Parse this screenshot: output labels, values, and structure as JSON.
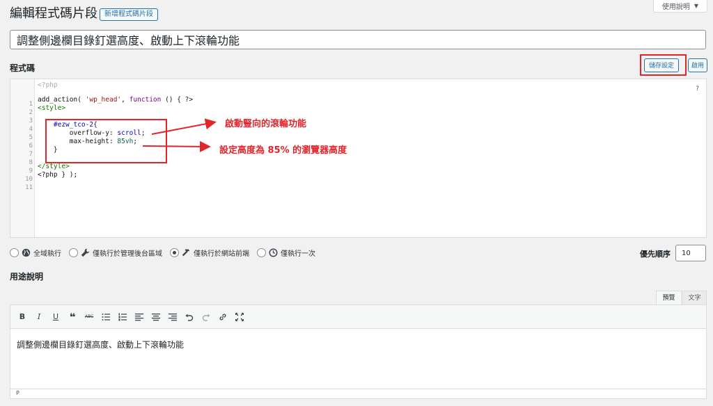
{
  "help_tab": {
    "label": "使用說明"
  },
  "header": {
    "title": "編輯程式碼片段",
    "add_new_label": "新增程式碼片段"
  },
  "snippet": {
    "title_value": "調整側邊欄目錄釘選高度、啟動上下滾輪功能"
  },
  "code_section": {
    "label": "程式碼",
    "save_label": "儲存設定",
    "activate_label": "啟用",
    "help_mark": "?",
    "open_tag": "<?php",
    "line_numbers": [
      "1",
      "2",
      "3",
      "4",
      "5",
      "6",
      "7",
      "8",
      "9",
      "10",
      "11"
    ]
  },
  "code": {
    "l1_fn": "add_action",
    "l1_p1": "( ",
    "l1_str": "'wp_head'",
    "l1_p2": ", ",
    "l1_kw": "function",
    "l1_p3": " () { ?>",
    "l2": "<style>",
    "l4_sel": "#ezw_tco-2",
    "l4_brace": "{",
    "l5_prop": "overflow-y: ",
    "l5_val": "scroll",
    "l5_end": ";",
    "l6_prop": "max-height: ",
    "l6_val": "85vh",
    "l6_end": ";",
    "l7": "}",
    "l9": "</style>",
    "l10": "<?php } );"
  },
  "annotations": {
    "first": "啟動豎向的滾輪功能",
    "second": "設定高度為 85% 的瀏覽器高度"
  },
  "scope": {
    "options": [
      {
        "label": "全域執行",
        "icon": "globe-icon",
        "checked": false
      },
      {
        "label": "僅執行於管理後台區域",
        "icon": "wrench-icon",
        "checked": false
      },
      {
        "label": "僅執行於網站前端",
        "icon": "hammer-icon",
        "checked": true
      },
      {
        "label": "僅執行一次",
        "icon": "clock-icon",
        "checked": false
      }
    ]
  },
  "priority": {
    "label": "優先順序",
    "value": "10"
  },
  "description": {
    "label": "用途說明",
    "tab_visual": "預覽",
    "tab_text": "文字",
    "content": "調整側邊欄目錄釘選高度、啟動上下滾輪功能",
    "status_path": "P",
    "toolbar": {
      "bold": "B",
      "italic": "I",
      "underline": "U",
      "quote": "❝",
      "strike": "ABC"
    }
  },
  "colors": {
    "accent": "#2271b1",
    "annotation": "#e3242b"
  }
}
